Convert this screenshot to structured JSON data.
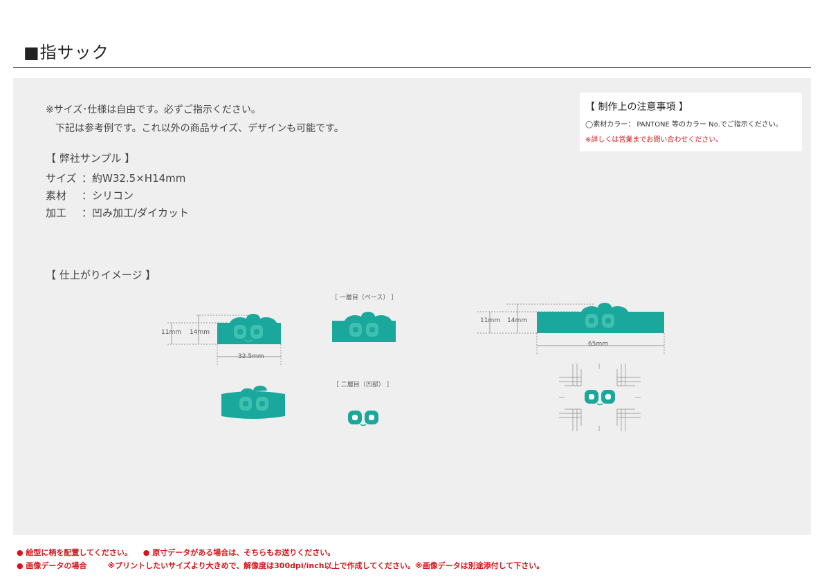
{
  "header": {
    "title": "■指サック"
  },
  "intro": {
    "line1": "※サイズ･仕様は自由です。必ずご指示ください。",
    "line2": "下記は参考例です。これ以外の商品サイズ、デザインも可能です。"
  },
  "sample": {
    "title": "【 弊社サンプル 】",
    "rows": [
      {
        "key": "サイズ",
        "value": "：約W32.5×H14mm"
      },
      {
        "key": "素材",
        "value": "：シリコン"
      },
      {
        "key": "加工",
        "value": "：凹み加工/ダイカット"
      }
    ]
  },
  "image_section": {
    "title": "【 仕上がりイメージ 】"
  },
  "layers": {
    "base_label": "［ 一層目（ベース） ］",
    "emboss_label": "［ 二層目（凹部） ］"
  },
  "dimensions": {
    "small_h_outer": "11mm",
    "small_h_inner": "14mm",
    "small_width": "32.5mm",
    "large_h_outer": "11mm",
    "large_h_inner": "14mm",
    "large_width": "65mm"
  },
  "notes": {
    "title": "【 制作上の注意事項 】",
    "line1": "◯素材カラー： PANTONE 等のカラー No.でご指示ください。",
    "line2": "※詳しくは営業までお問い合わせください。"
  },
  "footer": {
    "item1": "● 絵型に柄を配置してください。",
    "item2": "● 原寸データがある場合は、そちらもお送りください。",
    "item3": "● 画像データの場合",
    "item4": "※プリントしたいサイズより大きめで、解像度は300dpi/inch以上で作成してください。※画像データは別途添付して下さい。"
  },
  "colors": {
    "accent": "#1aa89c",
    "accent_dark": "#0f8f84",
    "warning": "#d7141a"
  }
}
